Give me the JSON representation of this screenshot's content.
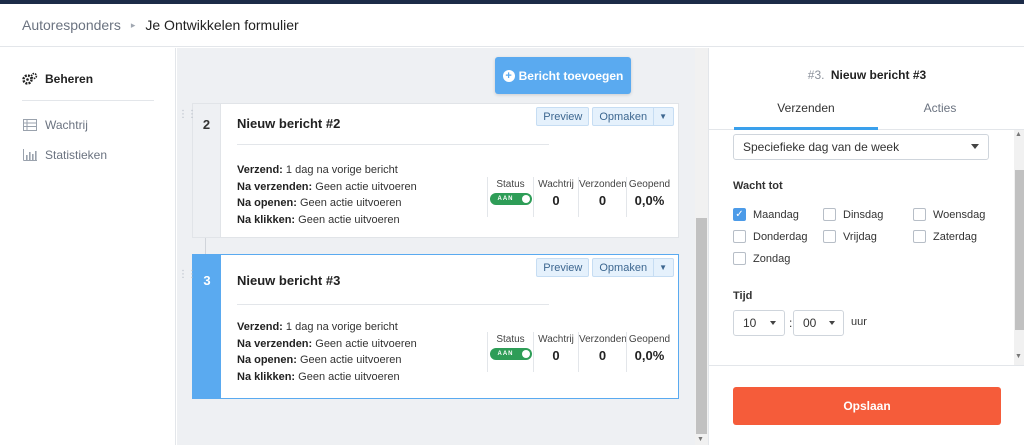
{
  "breadcrumb": {
    "parent": "Autoresponders",
    "separator": "▸",
    "current": "Je Ontwikkelen formulier"
  },
  "sidebar": {
    "items": [
      {
        "label": "Beheren",
        "icon": "gears-icon",
        "active": true
      },
      {
        "label": "Wachtrij",
        "icon": "list-icon"
      },
      {
        "label": "Statistieken",
        "icon": "bar-chart-icon"
      }
    ]
  },
  "main": {
    "add_button": "Bericht toevoegen",
    "messages": [
      {
        "number": "2",
        "title": "Nieuw bericht #2",
        "preview": "Preview",
        "edit": "Opmaken",
        "info": [
          {
            "key": "Verzend:",
            "value": " 1 dag na vorige bericht"
          },
          {
            "key": "Na verzenden:",
            "value": " Geen actie uitvoeren"
          },
          {
            "key": "Na openen:",
            "value": " Geen actie uitvoeren"
          },
          {
            "key": "Na klikken:",
            "value": " Geen actie uitvoeren"
          }
        ],
        "stats": {
          "status_label": "Status",
          "status_value": "AAN",
          "queue_label": "Wachtrij",
          "queue": "0",
          "sent_label": "Verzonden",
          "sent": "0",
          "opened_label": "Geopend",
          "opened": "0,0%"
        }
      },
      {
        "number": "3",
        "title": "Nieuw bericht #3",
        "preview": "Preview",
        "edit": "Opmaken",
        "info": [
          {
            "key": "Verzend:",
            "value": " 1 dag na vorige bericht"
          },
          {
            "key": "Na verzenden:",
            "value": " Geen actie uitvoeren"
          },
          {
            "key": "Na openen:",
            "value": " Geen actie uitvoeren"
          },
          {
            "key": "Na klikken:",
            "value": " Geen actie uitvoeren"
          }
        ],
        "stats": {
          "status_label": "Status",
          "status_value": "AAN",
          "queue_label": "Wachtrij",
          "queue": "0",
          "sent_label": "Verzonden",
          "sent": "0",
          "opened_label": "Geopend",
          "opened": "0,0%"
        }
      }
    ]
  },
  "panel": {
    "index": "#3.",
    "name": "Nieuw bericht #3",
    "tabs": [
      "Verzenden",
      "Acties"
    ],
    "select_value": "Speciefieke dag van de week",
    "wait_label": "Wacht tot",
    "days": [
      {
        "label": "Maandag",
        "checked": true
      },
      {
        "label": "Dinsdag",
        "checked": false
      },
      {
        "label": "Woensdag",
        "checked": false
      },
      {
        "label": "Donderdag",
        "checked": false
      },
      {
        "label": "Vrijdag",
        "checked": false
      },
      {
        "label": "Zaterdag",
        "checked": false
      },
      {
        "label": "Zondag",
        "checked": false
      }
    ],
    "time_label": "Tijd",
    "hour": "10",
    "minute": "00",
    "colon": ":",
    "unit": "uur",
    "save": "Opslaan"
  },
  "colors": {
    "accent": "#5aaaf0",
    "save": "#f55c3a",
    "toggle_on": "#2e9d57",
    "topbar": "#1c2b48"
  }
}
